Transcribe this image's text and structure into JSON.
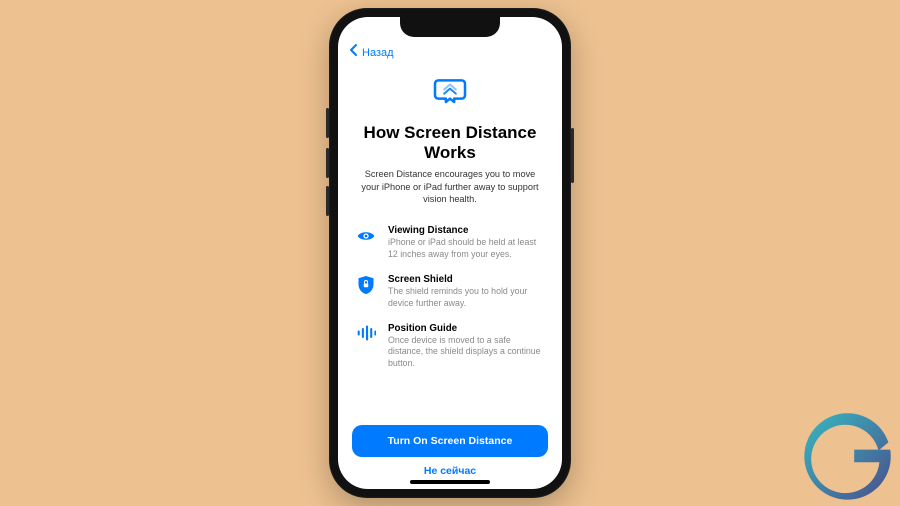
{
  "colors": {
    "accent": "#007aff",
    "background": "#edc190"
  },
  "nav": {
    "back_label": "Назад"
  },
  "hero": {
    "icon": "screen-distance-icon"
  },
  "title": "How Screen Distance Works",
  "subtitle": "Screen Distance encourages you to move your iPhone or iPad further away to support vision health.",
  "features": [
    {
      "icon": "eye-icon",
      "title": "Viewing Distance",
      "desc": "iPhone or iPad should be held at least 12 inches away from your eyes."
    },
    {
      "icon": "shield-icon",
      "title": "Screen Shield",
      "desc": "The shield reminds you to hold your device further away."
    },
    {
      "icon": "bars-icon",
      "title": "Position Guide",
      "desc": "Once device is moved to a safe distance, the shield displays a continue button."
    }
  ],
  "buttons": {
    "primary": "Turn On Screen Distance",
    "secondary": "Не сейчас"
  },
  "watermark": {
    "letter": "G"
  }
}
